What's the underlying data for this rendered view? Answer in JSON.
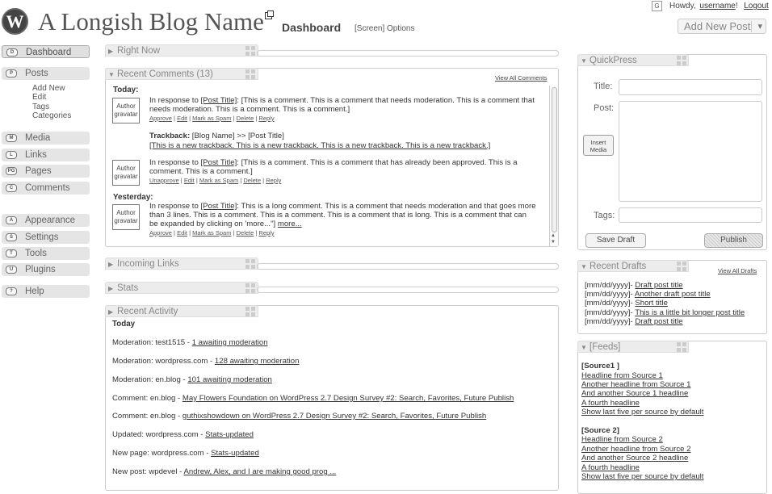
{
  "header": {
    "logo_letter": "W",
    "blog_name": "A Longish Blog Name",
    "page_title": "Dashboard",
    "screen_options": "[Screen] Options",
    "gravatar_letter": "G",
    "howdy": "Howdy,",
    "username": "username",
    "logout": "Logout",
    "add_new_post": "Add New Post",
    "dropdown_glyph": "▾"
  },
  "sidebar": {
    "dashboard": {
      "icon": "D",
      "label": "Dashboard"
    },
    "posts": {
      "icon": "P",
      "label": "Posts"
    },
    "posts_sub": [
      "Add New",
      "Edit",
      "Tags",
      "Categories"
    ],
    "media": {
      "icon": "M",
      "label": "Media"
    },
    "links": {
      "icon": "L",
      "label": "Links"
    },
    "pages": {
      "icon": "PG",
      "label": "Pages"
    },
    "comments": {
      "icon": "C",
      "label": "Comments"
    },
    "appearance": {
      "icon": "A",
      "label": "Appearance"
    },
    "settings": {
      "icon": "S",
      "label": "Settings"
    },
    "tools": {
      "icon": "T",
      "label": "Tools"
    },
    "plugins": {
      "icon": "U",
      "label": "Plugins"
    },
    "help": {
      "icon": "?",
      "label": "Help"
    }
  },
  "right_now": {
    "title": "Right Now"
  },
  "recent_comments": {
    "title": "Recent Comments (13)",
    "view_all": "View All Comments",
    "today_label": "Today:",
    "yesterday_label": "Yesterday:",
    "avatar_text": "Author gravatar",
    "c1": {
      "pre": "In response to ",
      "post": "[Post Title]",
      "text": ": [This is a comment. This is a comment that needs moderation. This is a comment that needs moderation. This is a comment. This is a comment.]"
    },
    "c1_actions": [
      "Approve",
      "Edit",
      "Mark as Spam",
      "Delete",
      "Reply"
    ],
    "tb": {
      "label": "Trackback:",
      "text": " [Blog Name] >> [Post Title]",
      "link": "[This is a new trackback. This is a new trackback. This is a new trackback. This is a new trackback.]"
    },
    "c2": {
      "pre": "In response to ",
      "post": "[Post Title]",
      "text": ": [This is a comment. This is a comment that has already been approved. This is a comment. This is a comment.]"
    },
    "c2_actions": [
      "Unapprove",
      "Edit",
      "Mark as Spam",
      "Delete",
      "Reply"
    ],
    "c3": {
      "pre": "In response to ",
      "post": "[Post Title]",
      "text": ": This is a long comment. This is a comment that needs moderation and that goes more than 3 lines. This is a comment. This is a comment. This is a comment that is long. This is a comment that can be expanded by clicking on 'more...\"]",
      "more": "more..."
    },
    "c3_actions": [
      "Approve",
      "Edit",
      "Mark as Spam",
      "Delete",
      "Reply"
    ]
  },
  "incoming_links": {
    "title": "Incoming Links"
  },
  "stats": {
    "title": "Stats"
  },
  "recent_activity": {
    "title": "Recent Activity",
    "today": "Today",
    "items": [
      {
        "text": "Moderation: test1515 - ",
        "link": "1 awaiting moderation"
      },
      {
        "text": "Moderation: wordpress.com - ",
        "link": "128 awaiting moderation"
      },
      {
        "text": "Moderation: en.blog - ",
        "link": "101 awaiting moderation"
      },
      {
        "text": "Comment: en.blog - ",
        "link": "May Flowers Foundation on WordPress 2.7 Design Survey #2: Search, Favorites, Future Publish"
      },
      {
        "text": "Comment: en.blog - ",
        "link": "guthixshowdown on WordPress 2.7 Design Survey #2: Search, Favorites, Future Publish"
      },
      {
        "text": "Updated: wordpress.com - ",
        "link": "Stats-updated"
      },
      {
        "text": "New page: wordpress.com - ",
        "link": "Stats-updated"
      },
      {
        "text": "New post: wpdevel - ",
        "link": "Andrew, Alex, and I are making good prog ..."
      }
    ]
  },
  "quickpress": {
    "title": "QuickPress",
    "title_label": "Title:",
    "post_label": "Post:",
    "insert_media": "Insert Media",
    "tags_label": "Tags:",
    "save_draft": "Save Draft",
    "publish": "Publish"
  },
  "recent_drafts": {
    "title": "Recent Drafts",
    "view_all": "View All Drafts",
    "items": [
      {
        "date": "[mm/dd/yyyy]- ",
        "title": "Draft post title"
      },
      {
        "date": "[mm/dd/yyyy]- ",
        "title": "Another draft post title"
      },
      {
        "date": "[mm/dd/yyyy]- ",
        "title": "Short title"
      },
      {
        "date": "[mm/dd/yyyy]- ",
        "title": "This is a little bit longer post title"
      },
      {
        "date": "[mm/dd/yyyy]- ",
        "title": "Draft post title"
      }
    ]
  },
  "feeds": {
    "title": "[Feeds]",
    "source1": "[Source1 ]",
    "source1_items": [
      "Headline from Source 1",
      "Another headline from Source 1",
      "And another Source 1 headline",
      "A fourth headline",
      "Show last five per source by default"
    ],
    "source2": "[Source 2]",
    "source2_items": [
      "Headline from Source 2",
      "Another headline from Source 2",
      "And another Source 2 headline",
      "A fourth headline",
      "Show last five per source by default"
    ]
  }
}
